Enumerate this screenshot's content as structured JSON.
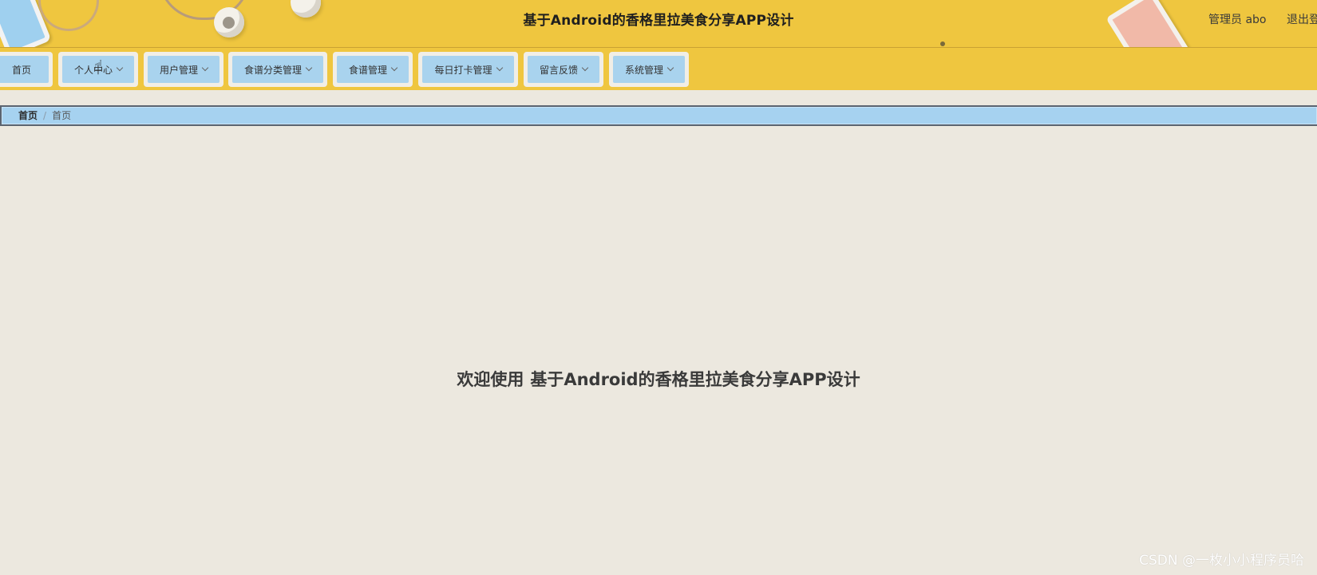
{
  "header": {
    "title": "基于Android的香格里拉美食分享APP设计",
    "user_label": "管理员 abo",
    "logout_label": "退出登录",
    "background_color": "#efc63f"
  },
  "nav": {
    "items": [
      {
        "label": "首页",
        "has_dropdown": false
      },
      {
        "label": "个人中心",
        "has_dropdown": true
      },
      {
        "label": "用户管理",
        "has_dropdown": true
      },
      {
        "label": "食谱分类管理",
        "has_dropdown": true
      },
      {
        "label": "食谱管理",
        "has_dropdown": true
      },
      {
        "label": "每日打卡管理",
        "has_dropdown": true
      },
      {
        "label": "留言反馈",
        "has_dropdown": true
      },
      {
        "label": "系统管理",
        "has_dropdown": true
      }
    ],
    "item_color": "#a9d3ee"
  },
  "breadcrumb": {
    "home": "首页",
    "separator": "/",
    "current": "首页"
  },
  "main": {
    "welcome_prefix": "欢迎使用",
    "welcome_title": "基于Android的香格里拉美食分享APP设计"
  },
  "watermark": {
    "text": "CSDN @一枚小小程序员哈"
  },
  "icons": {
    "dropdown": "chevron-down-icon",
    "cursor": "hand-pointer-icon"
  }
}
